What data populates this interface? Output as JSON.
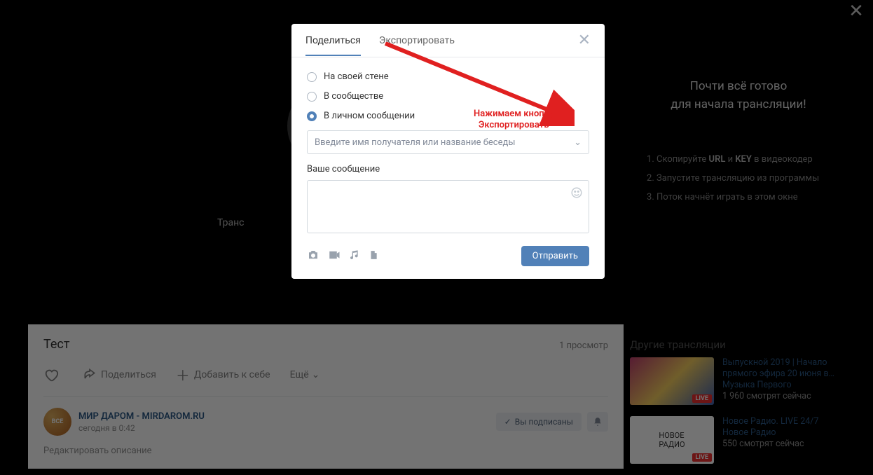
{
  "page": {
    "close_glyph": "✕",
    "spinner_label": "Транс",
    "title": "Тест",
    "views": "1 просмотр",
    "actions": {
      "like": "",
      "share": "Поделиться",
      "add": "Добавить к себе",
      "more": "Ещё"
    },
    "post": {
      "avatar_text": "ВСЕ",
      "author": "МИР ДАРОМ - MIRDAROM.RU",
      "time": "сегодня в 0:42",
      "subscribed": "Вы подписаны",
      "edit_desc": "Редактировать описание"
    }
  },
  "right": {
    "ready_l1": "Почти всё готово",
    "ready_l2": "для начала трансляции!",
    "steps": [
      {
        "pre": "Скопируйте ",
        "b1": "URL",
        "mid": " и ",
        "b2": "KEY",
        "post": " в видеокодер"
      },
      {
        "text": "Запустите трансляцию из программы"
      },
      {
        "text": "Поток начнёт играть в этом окне"
      }
    ],
    "others_heading": "Другие трансляции",
    "live_badge": "LIVE",
    "items": [
      {
        "title": "Выпускной 2019 | Начало прямого эфира 20 июня в…",
        "channel": "Музыка Первого",
        "watchers": "1 960 смотрят сейчас"
      },
      {
        "title": "Новое Радио. LIVE 24/7",
        "channel": "Новое Радио",
        "watchers": "550 смотрят сейчас"
      }
    ]
  },
  "modal": {
    "tabs": {
      "share": "Поделиться",
      "export": "Экспортировать"
    },
    "close_glyph": "✕",
    "radios": [
      {
        "label": "На своей стене",
        "selected": false
      },
      {
        "label": "В сообществе",
        "selected": false
      },
      {
        "label": "В личном сообщении",
        "selected": true
      }
    ],
    "recipient_placeholder": "Введите имя получателя или название беседы",
    "message_label": "Ваше сообщение",
    "send": "Отправить"
  },
  "annotation": {
    "l1": "Нажимаем кнопку",
    "l2": "Экспортировать"
  }
}
